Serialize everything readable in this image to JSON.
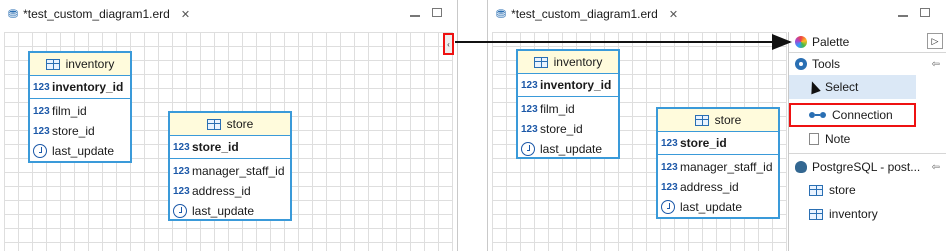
{
  "left_pane": {
    "tab_label": "*test_custom_diagram1.erd",
    "entities": [
      {
        "title": "inventory",
        "pk": {
          "type_badge": "123",
          "name": "inventory_id"
        },
        "attrs": [
          {
            "type_badge": "123",
            "name": "film_id"
          },
          {
            "type_badge": "123",
            "name": "store_id"
          },
          {
            "type_badge": "clock",
            "name": "last_update"
          }
        ]
      },
      {
        "title": "store",
        "pk": {
          "type_badge": "123",
          "name": "store_id"
        },
        "attrs": [
          {
            "type_badge": "123",
            "name": "manager_staff_id"
          },
          {
            "type_badge": "123",
            "name": "address_id"
          },
          {
            "type_badge": "clock",
            "name": "last_update"
          }
        ]
      }
    ]
  },
  "right_pane": {
    "tab_label": "*test_custom_diagram1.erd",
    "entities": [
      {
        "title": "inventory",
        "pk": {
          "type_badge": "123",
          "name": "inventory_id"
        },
        "attrs": [
          {
            "type_badge": "123",
            "name": "film_id"
          },
          {
            "type_badge": "123",
            "name": "store_id"
          },
          {
            "type_badge": "clock",
            "name": "last_update"
          }
        ]
      },
      {
        "title": "store",
        "pk": {
          "type_badge": "123",
          "name": "store_id"
        },
        "attrs": [
          {
            "type_badge": "123",
            "name": "manager_staff_id"
          },
          {
            "type_badge": "123",
            "name": "address_id"
          },
          {
            "type_badge": "clock",
            "name": "last_update"
          }
        ]
      }
    ],
    "palette": {
      "title": "Palette",
      "toggle_glyph": "▷",
      "tools_section": "Tools",
      "collapse_glyph": "⇦",
      "items": {
        "select": "Select",
        "connection": "Connection",
        "note": "Note"
      },
      "db_section": "PostgreSQL - post...",
      "db_items": [
        "store",
        "inventory"
      ]
    }
  },
  "colors": {
    "entity_border": "#3a9ad9",
    "entity_header_bg": "#fffbdc",
    "highlight": "#e11111",
    "selected_bg": "#dbe8f6"
  }
}
